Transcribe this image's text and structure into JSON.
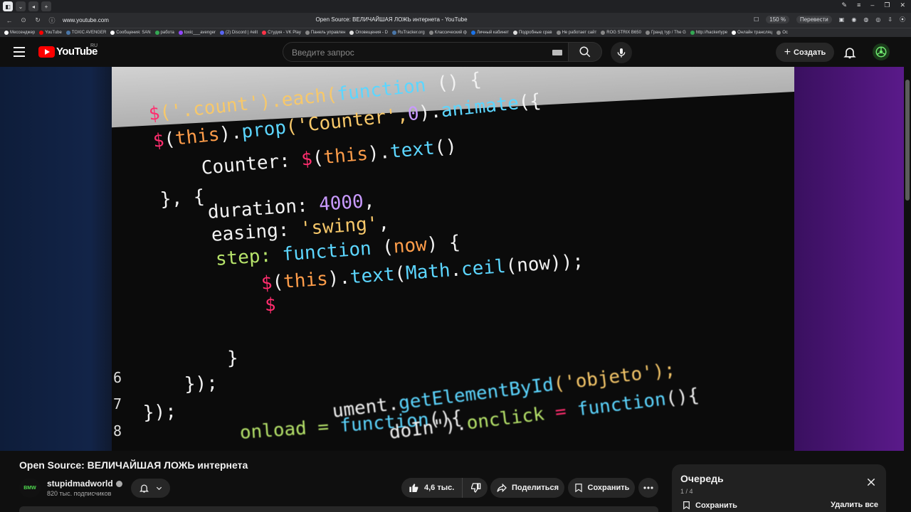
{
  "browser": {
    "tab_title": "Open Source: ВЕЛИЧАЙШАЯ ЛОЖЬ интернета - YouTube",
    "url": "www.youtube.com",
    "zoom": "150 %",
    "translate": "Перевести",
    "bookmarks": [
      {
        "label": "Мессенджер",
        "color": "#ffffff"
      },
      {
        "label": "YouTube",
        "color": "#ff0000"
      },
      {
        "label": "TOXIC AVENGER",
        "color": "#4a76a8"
      },
      {
        "label": "Сообщения: SAN",
        "color": "#ffffff"
      },
      {
        "label": "работа",
        "color": "#34a853"
      },
      {
        "label": "toxic___avenger",
        "color": "#9146ff"
      },
      {
        "label": "(2) Discord | #elit",
        "color": "#5865f2"
      },
      {
        "label": "Студия - VK Play",
        "color": "#ff3347"
      },
      {
        "label": "Панель управлен",
        "color": "#888888"
      },
      {
        "label": "Оповещения - D",
        "color": "#dddddd"
      },
      {
        "label": "RuTracker.org",
        "color": "#4a76a8"
      },
      {
        "label": "Классический ф",
        "color": "#888888"
      },
      {
        "label": "Личный кабинет",
        "color": "#1a73e8"
      },
      {
        "label": "Подробные срав",
        "color": "#dddddd"
      },
      {
        "label": "Не работает сайт",
        "color": "#888888"
      },
      {
        "label": "ROG STRIX B650",
        "color": "#888888"
      },
      {
        "label": "Гранд тур / The G",
        "color": "#888888"
      },
      {
        "label": "http://hackertype",
        "color": "#34a853"
      },
      {
        "label": "Онлайн трансляц",
        "color": "#ffffff"
      },
      {
        "label": "Ос",
        "color": "#888888"
      }
    ]
  },
  "header": {
    "logo_text": "YouTube",
    "region": "RU",
    "search_placeholder": "Введите запрос",
    "create_label": "Создать"
  },
  "video": {
    "title": "Open Source: ВЕЛИЧАЙШАЯ ЛОЖЬ интернета",
    "code_lines": [
      {
        "parts": [
          [
            "$",
            "c-pink"
          ],
          [
            "('.count').each(",
            "c-yel"
          ],
          [
            "function",
            "c-cyan"
          ],
          [
            " () {",
            "c-wht"
          ]
        ]
      },
      {
        "parts": [
          [
            "$",
            "c-pink"
          ],
          [
            "(",
            "c-wht"
          ],
          [
            "this",
            "c-ora"
          ],
          [
            ").",
            "c-wht"
          ],
          [
            "prop",
            "c-cyan"
          ],
          [
            "('Counter',",
            "c-yel"
          ],
          [
            "0",
            "c-vio"
          ],
          [
            ").",
            "c-wht"
          ],
          [
            "animate",
            "c-cyan"
          ],
          [
            "({",
            "c-wht"
          ]
        ]
      },
      {
        "parts": [
          [
            "Counter: ",
            "c-wht"
          ],
          [
            "$",
            "c-pink"
          ],
          [
            "(",
            "c-wht"
          ],
          [
            "this",
            "c-ora"
          ],
          [
            ").",
            "c-wht"
          ],
          [
            "text",
            "c-cyan"
          ],
          [
            "()",
            "c-wht"
          ]
        ]
      },
      {
        "parts": [
          [
            "}, {",
            "c-wht"
          ]
        ]
      },
      {
        "parts": [
          [
            "duration: ",
            "c-wht"
          ],
          [
            "4000",
            "c-vio"
          ],
          [
            ",",
            "c-wht"
          ]
        ]
      },
      {
        "parts": [
          [
            "easing: ",
            "c-wht"
          ],
          [
            "'swing'",
            "c-yel"
          ],
          [
            ",",
            "c-wht"
          ]
        ]
      },
      {
        "parts": [
          [
            "step: ",
            "c-grn"
          ],
          [
            "function",
            "c-cyan"
          ],
          [
            " (",
            "c-wht"
          ],
          [
            "now",
            "c-ora"
          ],
          [
            ") {",
            "c-wht"
          ]
        ]
      },
      {
        "parts": [
          [
            "$",
            "c-pink"
          ],
          [
            "(",
            "c-wht"
          ],
          [
            "this",
            "c-ora"
          ],
          [
            ").",
            "c-wht"
          ],
          [
            "text",
            "c-cyan"
          ],
          [
            "(",
            "c-wht"
          ],
          [
            "Math",
            "c-cyan"
          ],
          [
            ".",
            "c-wht"
          ],
          [
            "ceil",
            "c-cyan"
          ],
          [
            "(now));",
            "c-wht"
          ]
        ]
      },
      {
        "parts": [
          [
            "$",
            "c-pink"
          ]
        ]
      },
      {
        "parts": [
          [
            "}",
            "c-wht"
          ]
        ]
      },
      {
        "parts": [
          [
            "});",
            "c-wht"
          ]
        ]
      },
      {
        "parts": [
          [
            "});",
            "c-wht"
          ]
        ]
      },
      {
        "parts": [
          [
            "onload = ",
            "c-grn"
          ],
          [
            "function",
            "c-cyan"
          ],
          [
            "(){",
            "c-wht"
          ]
        ]
      },
      {
        "parts": [
          [
            "ument.",
            "c-wht"
          ],
          [
            "getElementById",
            "c-cyan"
          ],
          [
            "('objeto');",
            "c-yel"
          ]
        ]
      },
      {
        "parts": [
          [
            "doIn\").",
            "c-wht"
          ],
          [
            "onclick",
            "c-grn"
          ],
          [
            " = ",
            "c-pink"
          ],
          [
            "function",
            "c-cyan"
          ],
          [
            "(){",
            "c-wht"
          ]
        ]
      }
    ],
    "line_numbers": [
      "6",
      "7",
      "8"
    ]
  },
  "channel": {
    "avatar_text": "BMW",
    "name": "stupidmadworld",
    "subscribers": "820 тыс. подписчиков"
  },
  "actions": {
    "likes": "4,6 тыс.",
    "share": "Поделиться",
    "save": "Сохранить"
  },
  "queue": {
    "title": "Очередь",
    "count": "1 / 4",
    "save": "Сохранить",
    "clear": "Удалить все"
  }
}
